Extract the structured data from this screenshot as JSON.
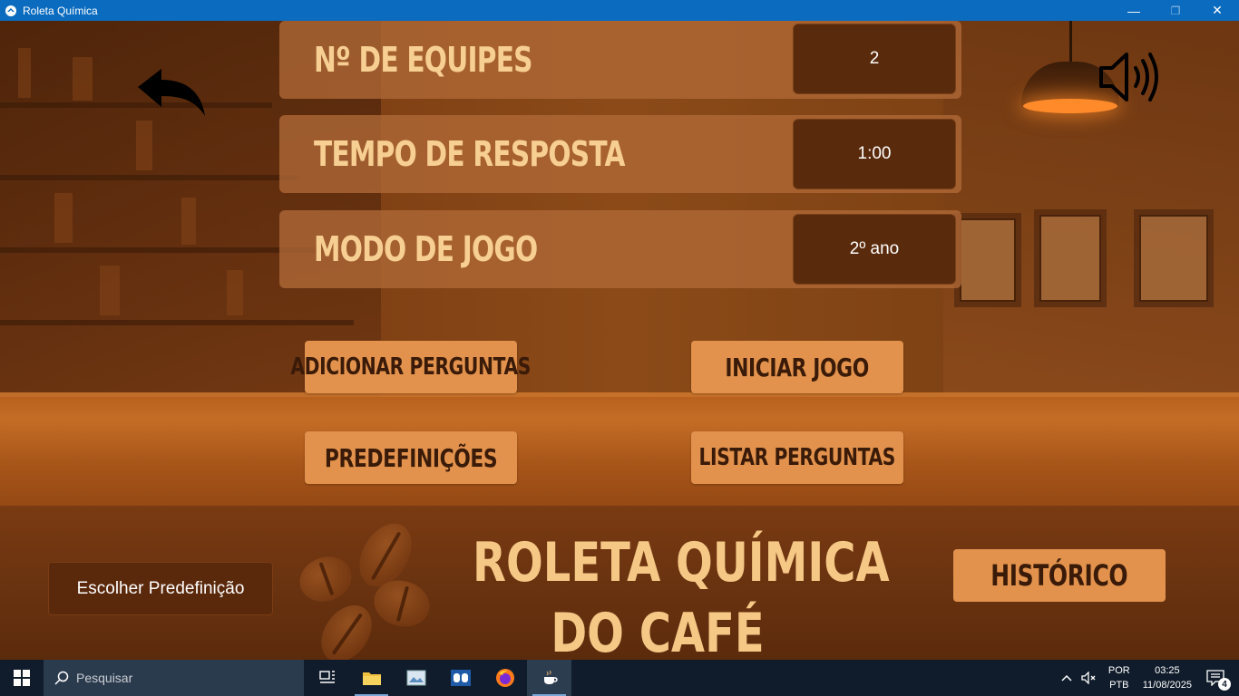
{
  "window": {
    "title": "Roleta Química",
    "minimize": "—",
    "restore": "❐",
    "close": "✕"
  },
  "settings": [
    {
      "label": "Nº DE EQUIPES",
      "value": "2"
    },
    {
      "label": "TEMPO DE RESPOSTA",
      "value": "1:00"
    },
    {
      "label": "MODO DE JOGO",
      "value": "2º ano"
    }
  ],
  "buttons": {
    "add_questions": "ADICIONAR PERGUNTAS",
    "start_game": "INICIAR JOGO",
    "presets": "PREDEFINIÇÕES",
    "list_questions": "LISTAR PERGUNTAS",
    "choose_preset": "Escolher Predefinição",
    "history": "HISTÓRICO"
  },
  "game_title": {
    "line1": "ROLETA QUÍMICA",
    "line2": "DO CAFÉ"
  },
  "icons": {
    "back": "back-arrow-icon",
    "sound": "speaker-volume-icon"
  },
  "taskbar": {
    "search_placeholder": "Pesquisar",
    "language_top": "POR",
    "language_bottom": "PTB",
    "time": "03:25",
    "date": "11/08/2025",
    "notification_count": "4"
  },
  "colors": {
    "titlebar": "#0a6bbf",
    "row_bg": "#b06937",
    "value_bg": "#5a2a0c",
    "button_bg": "#e2924c",
    "title_text": "#f6c886"
  }
}
